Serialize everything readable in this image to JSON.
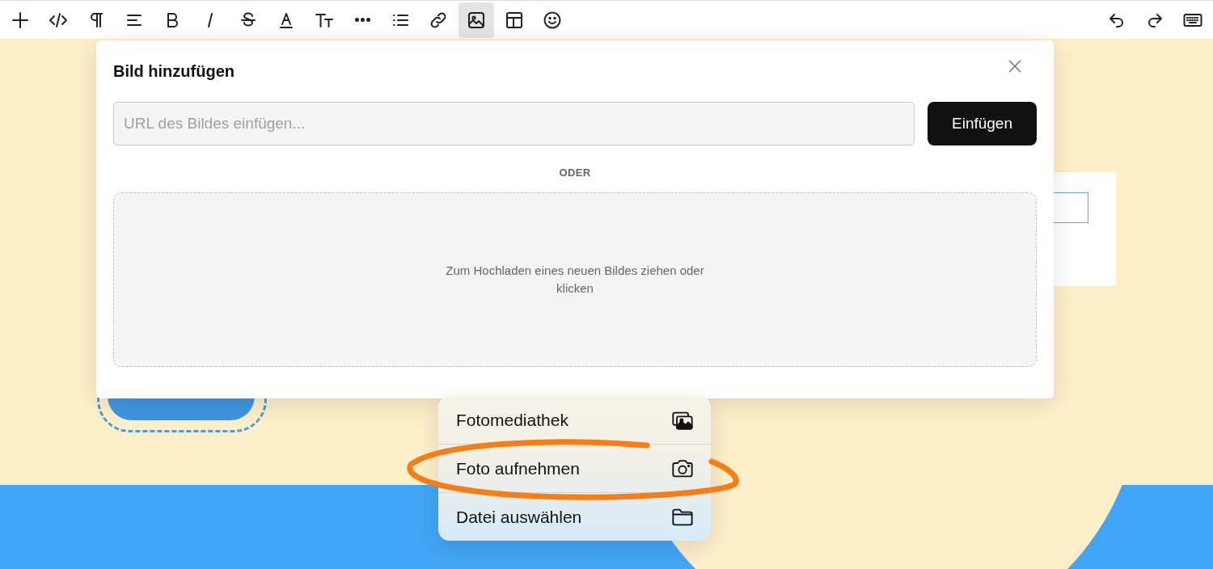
{
  "toolbar": {
    "items": [
      {
        "kind": "plus",
        "selected": false
      },
      {
        "kind": "code",
        "selected": false
      },
      {
        "kind": "pilcrow",
        "selected": false
      },
      {
        "kind": "align",
        "selected": false
      },
      {
        "kind": "bold",
        "selected": false
      },
      {
        "kind": "italic",
        "selected": false
      },
      {
        "kind": "strike",
        "selected": false
      },
      {
        "kind": "textcolor",
        "selected": false
      },
      {
        "kind": "textsize",
        "selected": false
      },
      {
        "kind": "more",
        "selected": false
      },
      {
        "kind": "list",
        "selected": false
      },
      {
        "kind": "link",
        "selected": false
      },
      {
        "kind": "image",
        "selected": true
      },
      {
        "kind": "table",
        "selected": false
      },
      {
        "kind": "emoji",
        "selected": false
      }
    ],
    "right_items": [
      {
        "kind": "undo"
      },
      {
        "kind": "redo"
      },
      {
        "kind": "keyboard"
      }
    ]
  },
  "dialog": {
    "title": "Bild hinzufügen",
    "url_field": {
      "placeholder": "URL des Bildes einfügen..."
    },
    "insert_button": "Einfügen",
    "separator": "ODER",
    "dropzone_text": "Zum Hochladen eines neuen Bildes ziehen oder klicken"
  },
  "source_menu": {
    "items": [
      {
        "label": "Fotomediathek",
        "kind": "photos",
        "circled": false
      },
      {
        "label": "Foto aufnehmen",
        "kind": "camera",
        "circled": true
      },
      {
        "label": "Datei auswählen",
        "kind": "folder",
        "circled": false
      }
    ]
  }
}
